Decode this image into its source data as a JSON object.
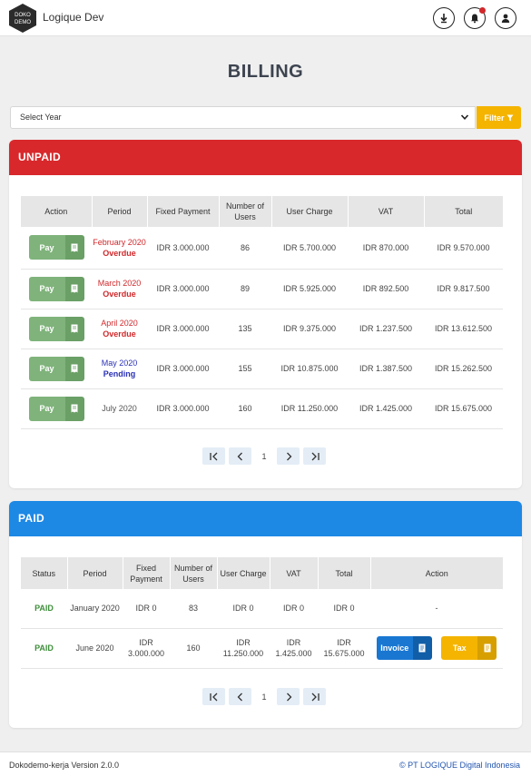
{
  "header": {
    "app_title": "Logique Dev",
    "logo_text_top": "DOKO",
    "logo_text_bottom": "DEMO",
    "icons": [
      "download-icon",
      "bell-icon",
      "user-icon"
    ]
  },
  "page_title": "BILLING",
  "filter": {
    "year_placeholder": "Select Year",
    "filter_label": "Filter"
  },
  "unpaid": {
    "title": "UNPAID",
    "headers": [
      "Action",
      "Period",
      "Fixed Payment",
      "Number of Users",
      "User Charge",
      "VAT",
      "Total"
    ],
    "pay_label": "Pay",
    "rows": [
      {
        "period": "February 2020",
        "status": "Overdue",
        "fixed": "IDR 3.000.000",
        "users": "86",
        "charge": "IDR 5.700.000",
        "vat": "IDR 870.000",
        "total": "IDR 9.570.000"
      },
      {
        "period": "March 2020",
        "status": "Overdue",
        "fixed": "IDR 3.000.000",
        "users": "89",
        "charge": "IDR 5.925.000",
        "vat": "IDR 892.500",
        "total": "IDR 9.817.500"
      },
      {
        "period": "April 2020",
        "status": "Overdue",
        "fixed": "IDR 3.000.000",
        "users": "135",
        "charge": "IDR 9.375.000",
        "vat": "IDR 1.237.500",
        "total": "IDR 13.612.500"
      },
      {
        "period": "May 2020",
        "status": "Pending",
        "fixed": "IDR 3.000.000",
        "users": "155",
        "charge": "IDR 10.875.000",
        "vat": "IDR 1.387.500",
        "total": "IDR 15.262.500"
      },
      {
        "period": "July 2020",
        "status": "",
        "fixed": "IDR 3.000.000",
        "users": "160",
        "charge": "IDR 11.250.000",
        "vat": "IDR 1.425.000",
        "total": "IDR 15.675.000"
      }
    ],
    "page": "1"
  },
  "paid": {
    "title": "PAID",
    "headers": [
      "Status",
      "Period",
      "Fixed Payment",
      "Number of Users",
      "User Charge",
      "VAT",
      "Total",
      "Action"
    ],
    "rows": [
      {
        "status": "PAID",
        "period": "January 2020",
        "fixed": "IDR 0",
        "users": "83",
        "charge": "IDR 0",
        "vat": "IDR 0",
        "total": "IDR 0",
        "action": "-"
      },
      {
        "status": "PAID",
        "period": "June 2020",
        "fixed": "IDR 3.000.000",
        "users": "160",
        "charge": "IDR 11.250.000",
        "vat": "IDR 1.425.000",
        "total": "IDR 15.675.000",
        "action": ""
      }
    ],
    "invoice_label": "Invoice",
    "tax_label": "Tax",
    "page": "1"
  },
  "footer": {
    "version": "Dokodemo-kerja Version 2.0.0",
    "copyright": "© PT LOGIQUE Digital Indonesia"
  },
  "colors": {
    "unpaid_header": "#d8282b",
    "paid_header": "#1e88e5",
    "pay_button": "#7fb37b",
    "filter_button": "#f4b400"
  }
}
